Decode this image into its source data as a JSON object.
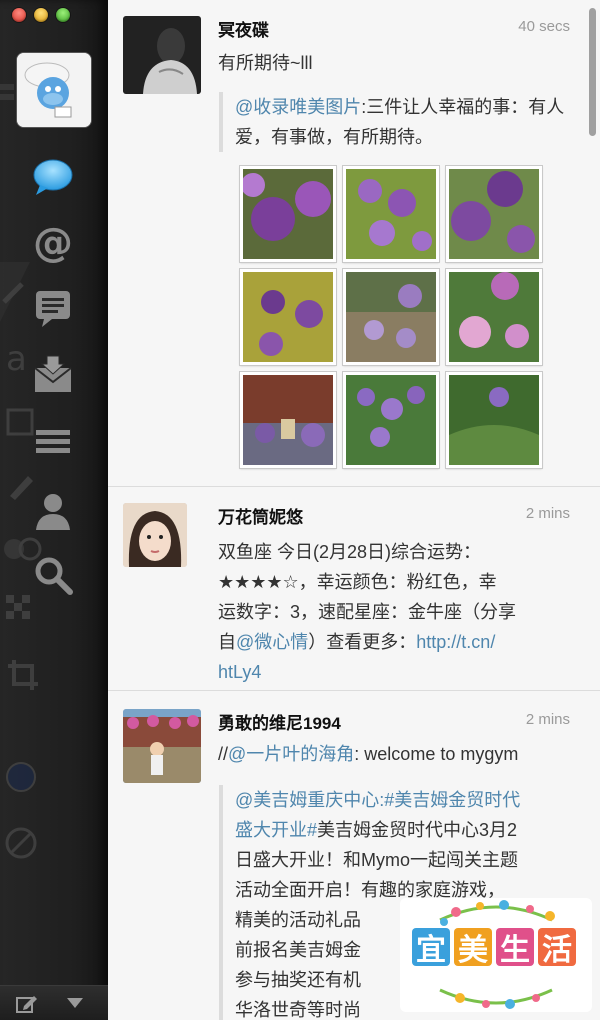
{
  "sidebar": {
    "nav": [
      {
        "name": "timeline",
        "icon": "speech-bubble-icon",
        "active": true
      },
      {
        "name": "mentions",
        "icon": "at-sign-icon"
      },
      {
        "name": "comments",
        "icon": "comments-icon"
      },
      {
        "name": "messages",
        "icon": "envelope-icon"
      },
      {
        "name": "lists",
        "icon": "list-icon"
      },
      {
        "name": "profile",
        "icon": "user-icon"
      },
      {
        "name": "search",
        "icon": "search-icon"
      }
    ],
    "active_color": "#4db8f2"
  },
  "tweets": [
    {
      "author": "冥夜碟",
      "time": "40 secs",
      "text": "有所期待~lll",
      "quote": {
        "mention": "@收录唯美图片",
        "text": ":三件让人幸福的事：有人爱，有事做，有所期待。"
      },
      "image_count": 9
    },
    {
      "author": "万花筒妮悠",
      "time": "2 mins",
      "text_lines": [
        "双鱼座 今日(2月28日)综合运势：",
        "★★★★☆，幸运颜色：粉红色，幸",
        "运数字：3，速配星座：金牛座（分享",
        "htLy4"
      ],
      "line3_prefix": "自",
      "line3_mention": "@微心情",
      "line3_mid": "）查看更多：",
      "line3_link": "http://t.cn/"
    },
    {
      "author": "勇敢的维尼1994",
      "time": "2 mins",
      "text_prefix": "//",
      "mention": "@一片叶的海角",
      "text_suffix": ": welcome to mygym",
      "quote": {
        "mention": "@美吉姆重庆中心",
        "hashtag": ":#美吉姆金贸时代",
        "lines": [
          "盛大开业#",
          "美吉姆金贸时代中心3月2",
          "日盛大开业！和Mymo一起闯关主题",
          "活动全面开启！有趣的家庭游戏，",
          "精美的活动礼品",
          "前报名美吉姆金",
          "参与抽奖还有机",
          "华洛世奇等时尚"
        ]
      }
    }
  ],
  "watermark": {
    "chars": [
      "宜",
      "美",
      "生",
      "活"
    ]
  }
}
